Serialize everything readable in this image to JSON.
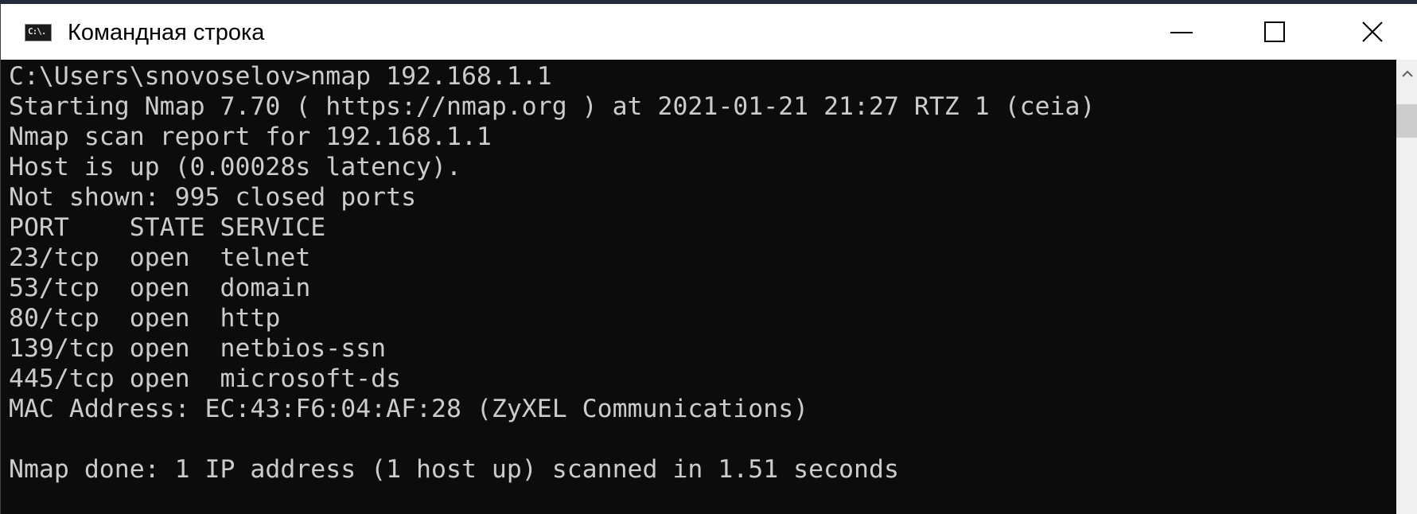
{
  "window": {
    "title": "Командная строка",
    "icon": "cmd-app-icon",
    "icon_glyph": "C:\\."
  },
  "controls": {
    "minimize_icon": "minimize-icon",
    "maximize_icon": "maximize-icon",
    "close_icon": "close-icon"
  },
  "console": {
    "lines": [
      "C:\\Users\\snovoselov>nmap 192.168.1.1",
      "Starting Nmap 7.70 ( https://nmap.org ) at 2021-01-21 21:27 RTZ 1 (ceia)",
      "Nmap scan report for 192.168.1.1",
      "Host is up (0.00028s latency).",
      "Not shown: 995 closed ports",
      "PORT    STATE SERVICE",
      "23/tcp  open  telnet",
      "53/tcp  open  domain",
      "80/tcp  open  http",
      "139/tcp open  netbios-ssn",
      "445/tcp open  microsoft-ds",
      "MAC Address: EC:43:F6:04:AF:28 (ZyXEL Communications)",
      "",
      "Nmap done: 1 IP address (1 host up) scanned in 1.51 seconds"
    ],
    "text_color": "#cccccc",
    "background": "#0c0c0c"
  },
  "scrollbar": {
    "up_icon": "scroll-up-arrow-icon"
  }
}
